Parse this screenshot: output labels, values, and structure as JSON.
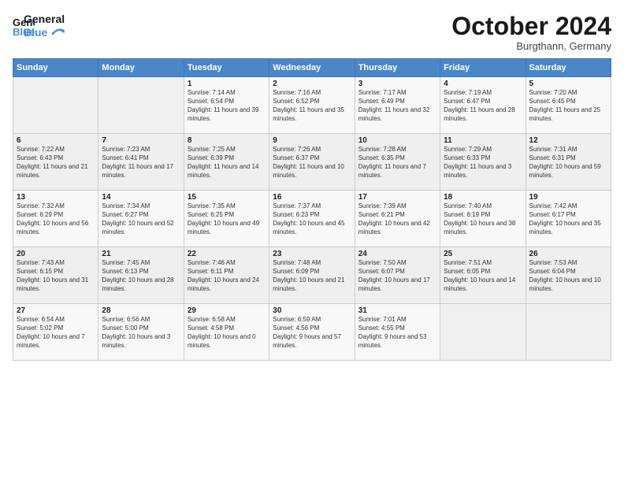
{
  "header": {
    "logo_line1": "General",
    "logo_line2": "Blue",
    "month": "October 2024",
    "location": "Burgthann, Germany"
  },
  "weekdays": [
    "Sunday",
    "Monday",
    "Tuesday",
    "Wednesday",
    "Thursday",
    "Friday",
    "Saturday"
  ],
  "weeks": [
    [
      {
        "day": "",
        "info": ""
      },
      {
        "day": "",
        "info": ""
      },
      {
        "day": "1",
        "info": "Sunrise: 7:14 AM\nSunset: 6:54 PM\nDaylight: 11 hours and 39 minutes."
      },
      {
        "day": "2",
        "info": "Sunrise: 7:16 AM\nSunset: 6:52 PM\nDaylight: 11 hours and 35 minutes."
      },
      {
        "day": "3",
        "info": "Sunrise: 7:17 AM\nSunset: 6:49 PM\nDaylight: 11 hours and 32 minutes."
      },
      {
        "day": "4",
        "info": "Sunrise: 7:19 AM\nSunset: 6:47 PM\nDaylight: 11 hours and 28 minutes."
      },
      {
        "day": "5",
        "info": "Sunrise: 7:20 AM\nSunset: 6:45 PM\nDaylight: 11 hours and 25 minutes."
      }
    ],
    [
      {
        "day": "6",
        "info": "Sunrise: 7:22 AM\nSunset: 6:43 PM\nDaylight: 11 hours and 21 minutes."
      },
      {
        "day": "7",
        "info": "Sunrise: 7:23 AM\nSunset: 6:41 PM\nDaylight: 11 hours and 17 minutes."
      },
      {
        "day": "8",
        "info": "Sunrise: 7:25 AM\nSunset: 6:39 PM\nDaylight: 11 hours and 14 minutes."
      },
      {
        "day": "9",
        "info": "Sunrise: 7:26 AM\nSunset: 6:37 PM\nDaylight: 11 hours and 10 minutes."
      },
      {
        "day": "10",
        "info": "Sunrise: 7:28 AM\nSunset: 6:35 PM\nDaylight: 11 hours and 7 minutes."
      },
      {
        "day": "11",
        "info": "Sunrise: 7:29 AM\nSunset: 6:33 PM\nDaylight: 11 hours and 3 minutes."
      },
      {
        "day": "12",
        "info": "Sunrise: 7:31 AM\nSunset: 6:31 PM\nDaylight: 10 hours and 59 minutes."
      }
    ],
    [
      {
        "day": "13",
        "info": "Sunrise: 7:32 AM\nSunset: 6:29 PM\nDaylight: 10 hours and 56 minutes."
      },
      {
        "day": "14",
        "info": "Sunrise: 7:34 AM\nSunset: 6:27 PM\nDaylight: 10 hours and 52 minutes."
      },
      {
        "day": "15",
        "info": "Sunrise: 7:35 AM\nSunset: 6:25 PM\nDaylight: 10 hours and 49 minutes."
      },
      {
        "day": "16",
        "info": "Sunrise: 7:37 AM\nSunset: 6:23 PM\nDaylight: 10 hours and 45 minutes."
      },
      {
        "day": "17",
        "info": "Sunrise: 7:39 AM\nSunset: 6:21 PM\nDaylight: 10 hours and 42 minutes."
      },
      {
        "day": "18",
        "info": "Sunrise: 7:40 AM\nSunset: 6:19 PM\nDaylight: 10 hours and 38 minutes."
      },
      {
        "day": "19",
        "info": "Sunrise: 7:42 AM\nSunset: 6:17 PM\nDaylight: 10 hours and 35 minutes."
      }
    ],
    [
      {
        "day": "20",
        "info": "Sunrise: 7:43 AM\nSunset: 6:15 PM\nDaylight: 10 hours and 31 minutes."
      },
      {
        "day": "21",
        "info": "Sunrise: 7:45 AM\nSunset: 6:13 PM\nDaylight: 10 hours and 28 minutes."
      },
      {
        "day": "22",
        "info": "Sunrise: 7:46 AM\nSunset: 6:11 PM\nDaylight: 10 hours and 24 minutes."
      },
      {
        "day": "23",
        "info": "Sunrise: 7:48 AM\nSunset: 6:09 PM\nDaylight: 10 hours and 21 minutes."
      },
      {
        "day": "24",
        "info": "Sunrise: 7:50 AM\nSunset: 6:07 PM\nDaylight: 10 hours and 17 minutes."
      },
      {
        "day": "25",
        "info": "Sunrise: 7:51 AM\nSunset: 6:05 PM\nDaylight: 10 hours and 14 minutes."
      },
      {
        "day": "26",
        "info": "Sunrise: 7:53 AM\nSunset: 6:04 PM\nDaylight: 10 hours and 10 minutes."
      }
    ],
    [
      {
        "day": "27",
        "info": "Sunrise: 6:54 AM\nSunset: 5:02 PM\nDaylight: 10 hours and 7 minutes."
      },
      {
        "day": "28",
        "info": "Sunrise: 6:56 AM\nSunset: 5:00 PM\nDaylight: 10 hours and 3 minutes."
      },
      {
        "day": "29",
        "info": "Sunrise: 6:58 AM\nSunset: 4:58 PM\nDaylight: 10 hours and 0 minutes."
      },
      {
        "day": "30",
        "info": "Sunrise: 6:59 AM\nSunset: 4:56 PM\nDaylight: 9 hours and 57 minutes."
      },
      {
        "day": "31",
        "info": "Sunrise: 7:01 AM\nSunset: 4:55 PM\nDaylight: 9 hours and 53 minutes."
      },
      {
        "day": "",
        "info": ""
      },
      {
        "day": "",
        "info": ""
      }
    ]
  ]
}
